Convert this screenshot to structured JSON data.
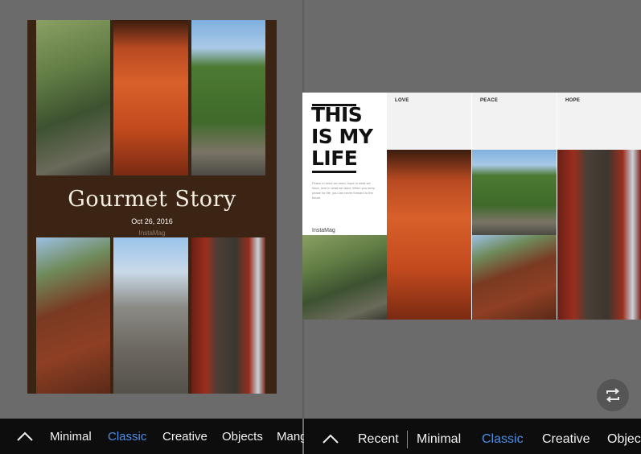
{
  "left_collage": {
    "title": "Gourmet Story",
    "date": "Oct 26, 2016",
    "brand": "InstaMag"
  },
  "right_collage": {
    "headline_lines": [
      "THIS",
      "IS MY",
      "LIFE"
    ],
    "description": "Peace in mind we need, hope in what we have, love in what we want. When you keep peace for life, you can never forward to the future.",
    "brand": "InstaMag",
    "labels": [
      "LOVE",
      "PEACE",
      "HOPE"
    ]
  },
  "left_tabs": [
    {
      "label": "Minimal",
      "active": false
    },
    {
      "label": "Classic",
      "active": true
    },
    {
      "label": "Creative",
      "active": false
    },
    {
      "label": "Objects",
      "active": false
    },
    {
      "label": "Mang",
      "active": false
    }
  ],
  "right_tabs": [
    {
      "label": "Recent",
      "active": false
    },
    {
      "label": "Minimal",
      "active": false
    },
    {
      "label": "Classic",
      "active": true
    },
    {
      "label": "Creative",
      "active": false
    },
    {
      "label": "Objec",
      "active": false
    }
  ],
  "icons": {
    "expand": "chevron-up-icon",
    "swap": "swap-icon"
  },
  "colors": {
    "background": "#6b6b6b",
    "collage_brown": "#3b2414",
    "bar": "#0d0d0d",
    "active_tab": "#4d8fe6"
  }
}
